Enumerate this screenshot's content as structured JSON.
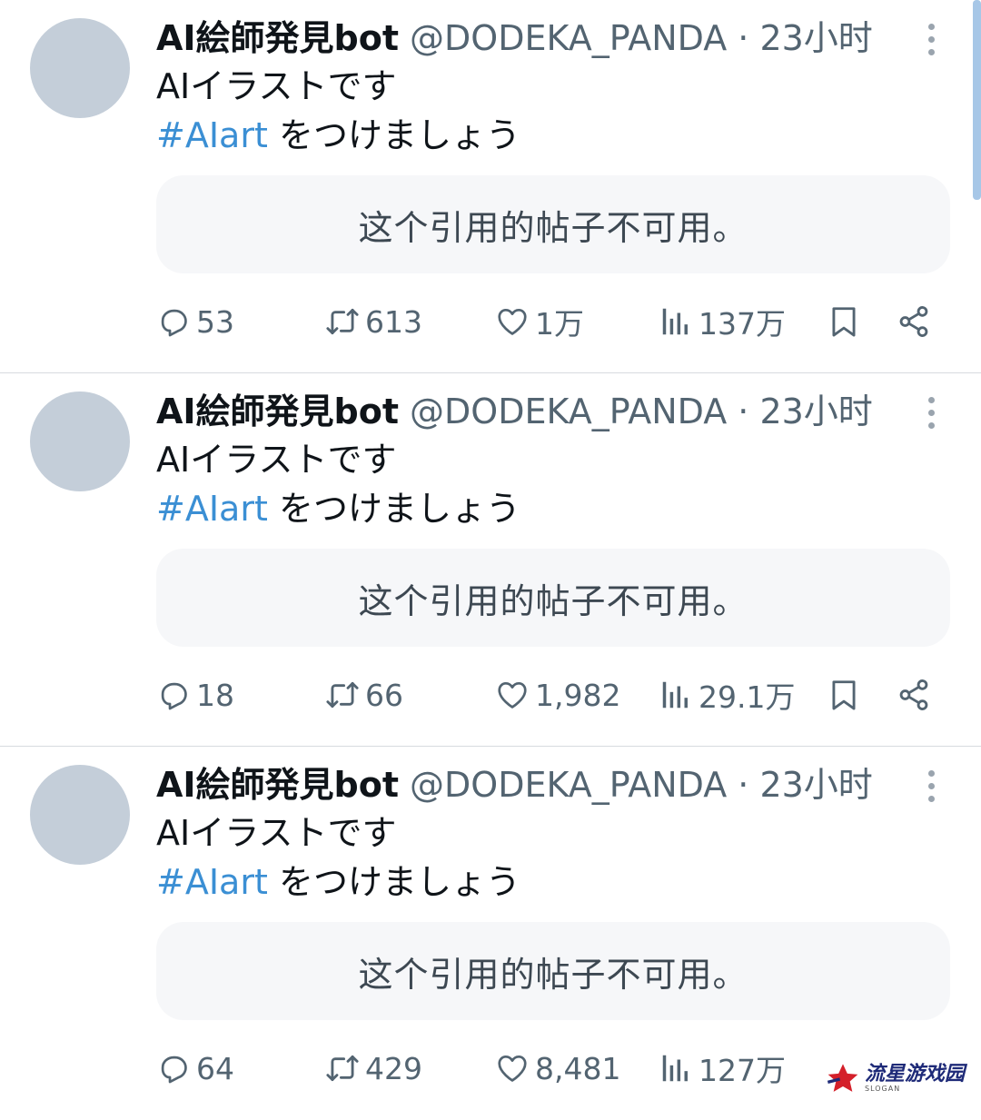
{
  "tweets": [
    {
      "author": "AI絵師発見bot",
      "meta": "@DODEKA_PANDA · 23小时",
      "line1": "AIイラストです",
      "hashtag": "#AIart",
      "line2_rest": " をつけましょう",
      "quote": "这个引用的帖子不可用。",
      "replies": "53",
      "reposts": "613",
      "likes": "1万",
      "views": "137万"
    },
    {
      "author": "AI絵師発見bot",
      "meta": "@DODEKA_PANDA · 23小时",
      "line1": "AIイラストです",
      "hashtag": "#AIart",
      "line2_rest": " をつけましょう",
      "quote": "这个引用的帖子不可用。",
      "replies": "18",
      "reposts": "66",
      "likes": "1,982",
      "views": "29.1万"
    },
    {
      "author": "AI絵師発見bot",
      "meta": "@DODEKA_PANDA · 23小时",
      "line1": "AIイラストです",
      "hashtag": "#AIart",
      "line2_rest": " をつけましょう",
      "quote": "这个引用的帖子不可用。",
      "replies": "64",
      "reposts": "429",
      "likes": "8,481",
      "views": "127万"
    }
  ],
  "watermark": {
    "title": "流星游戏园",
    "subtitle": "SLOGAN"
  },
  "colors": {
    "hashtag": "#3b8fd4",
    "secondary_text": "#536471",
    "avatar": "#c4ced9"
  }
}
